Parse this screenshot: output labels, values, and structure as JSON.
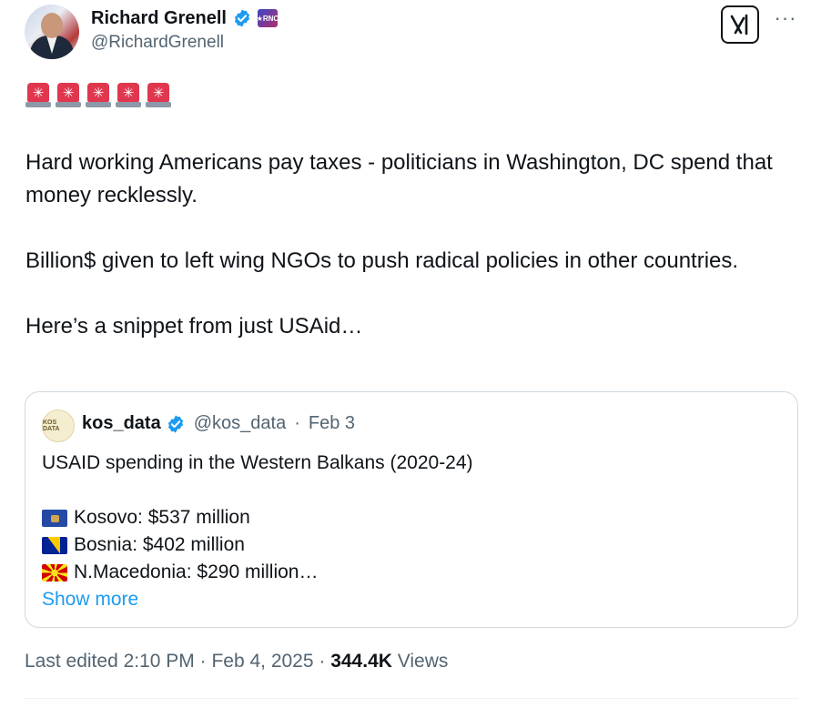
{
  "author": {
    "name": "Richard Grenell",
    "handle": "@RichardGrenell",
    "avatar_icon": "profile-photo",
    "affiliate_badge_text": "★RNC"
  },
  "header_actions": {
    "grok_icon": "grok-icon",
    "more_icon": "more-icon",
    "more_label": "···"
  },
  "post": {
    "sirens": [
      "✳",
      "✳",
      "✳",
      "✳",
      "✳"
    ],
    "paragraphs": [
      "Hard working Americans pay taxes - politicians in Washington, DC spend that money recklessly.",
      "Billion$ given to left wing NGOs to push radical policies in other countries.",
      "Here’s a snippet from just USAid…"
    ]
  },
  "quote": {
    "name": "kos_data",
    "handle": "@kos_data",
    "separator": "·",
    "date": "Feb 3",
    "avatar_text": "KOS DATA",
    "title": "USAID spending in the Western Balkans (2020-24)",
    "lines": [
      {
        "flag": "kosovo-flag",
        "text": "Kosovo: $537 million"
      },
      {
        "flag": "bosnia-flag",
        "text": "Bosnia: $402 million"
      },
      {
        "flag": "north-macedonia-flag",
        "text": "N.Macedonia: $290 million…"
      }
    ],
    "show_more": "Show more"
  },
  "meta": {
    "edited": "Last edited 2:10 PM · Feb 4, 2025 · ",
    "views_count": "344.4K",
    "views_label": " Views"
  },
  "colors": {
    "text": "#0f1419",
    "secondary": "#536471",
    "link": "#1d9bf0",
    "verified": "#1d9bf0",
    "border": "#cfd9de",
    "siren": "#e0374f"
  }
}
